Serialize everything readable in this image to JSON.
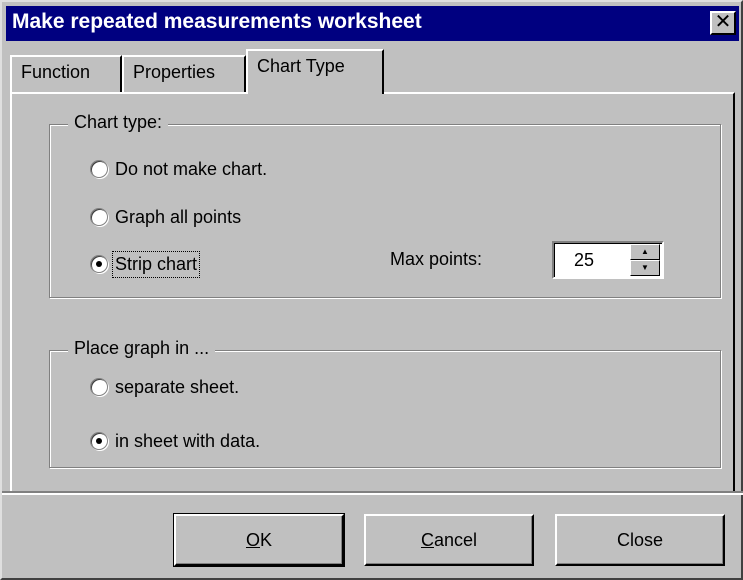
{
  "window": {
    "title": "Make repeated measurements worksheet",
    "close_glyph": "✕"
  },
  "tabs": [
    {
      "label": "Function",
      "active": false
    },
    {
      "label": "Properties",
      "active": false
    },
    {
      "label": "Chart Type",
      "active": true
    }
  ],
  "chart_type_group": {
    "legend": "Chart type:",
    "options": [
      {
        "label": "Do not make chart.",
        "checked": false
      },
      {
        "label": "Graph all points",
        "checked": false
      },
      {
        "label": "Strip chart",
        "checked": true
      }
    ],
    "max_points_label": "Max points:",
    "max_points_value": "25"
  },
  "place_group": {
    "legend": "Place graph in ...",
    "options": [
      {
        "label": "separate sheet.",
        "checked": false
      },
      {
        "label": "in sheet with data.",
        "checked": true
      }
    ]
  },
  "buttons": {
    "ok": {
      "mnemonic": "O",
      "rest": "K"
    },
    "cancel": {
      "mnemonic": "C",
      "rest": "ancel"
    },
    "close": {
      "label": "Close"
    }
  },
  "icons": {
    "spin_up": "▲",
    "spin_down": "▼"
  }
}
